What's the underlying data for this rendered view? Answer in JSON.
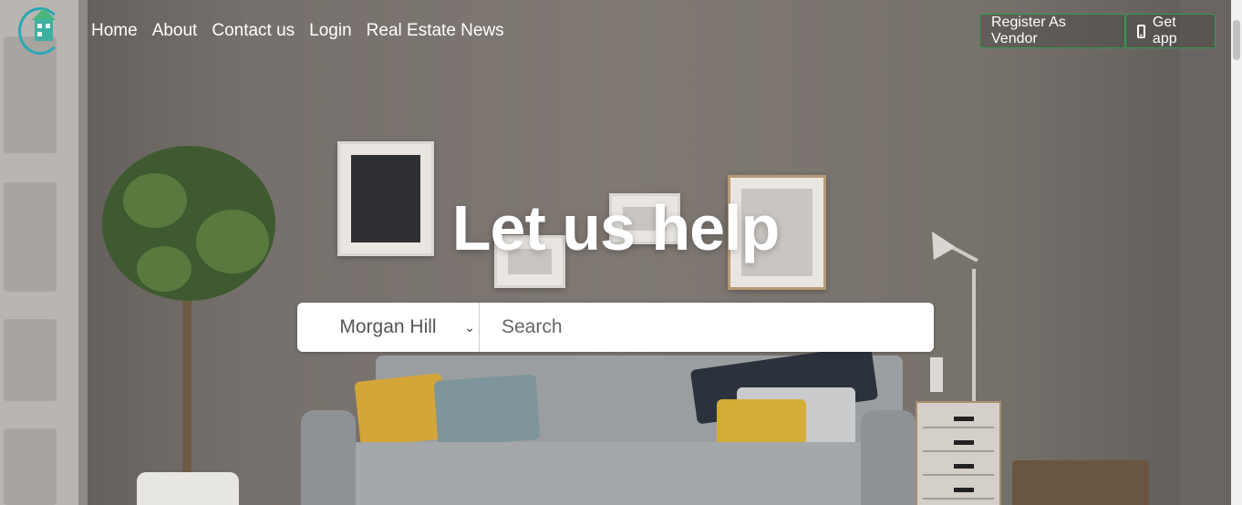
{
  "nav": {
    "logo_icon": "house-logo-icon",
    "links": [
      "Home",
      "About",
      "Contact us",
      "Login",
      "Real Estate News"
    ]
  },
  "buttons": {
    "register_vendor": "Register As Vendor",
    "get_app": "Get app",
    "get_app_icon": "mobile-phone-icon",
    "border_color": "#2f9e4a"
  },
  "hero": {
    "title": "Let us help"
  },
  "search": {
    "city_selected": "Morgan Hill",
    "placeholder": "Search",
    "value": ""
  }
}
